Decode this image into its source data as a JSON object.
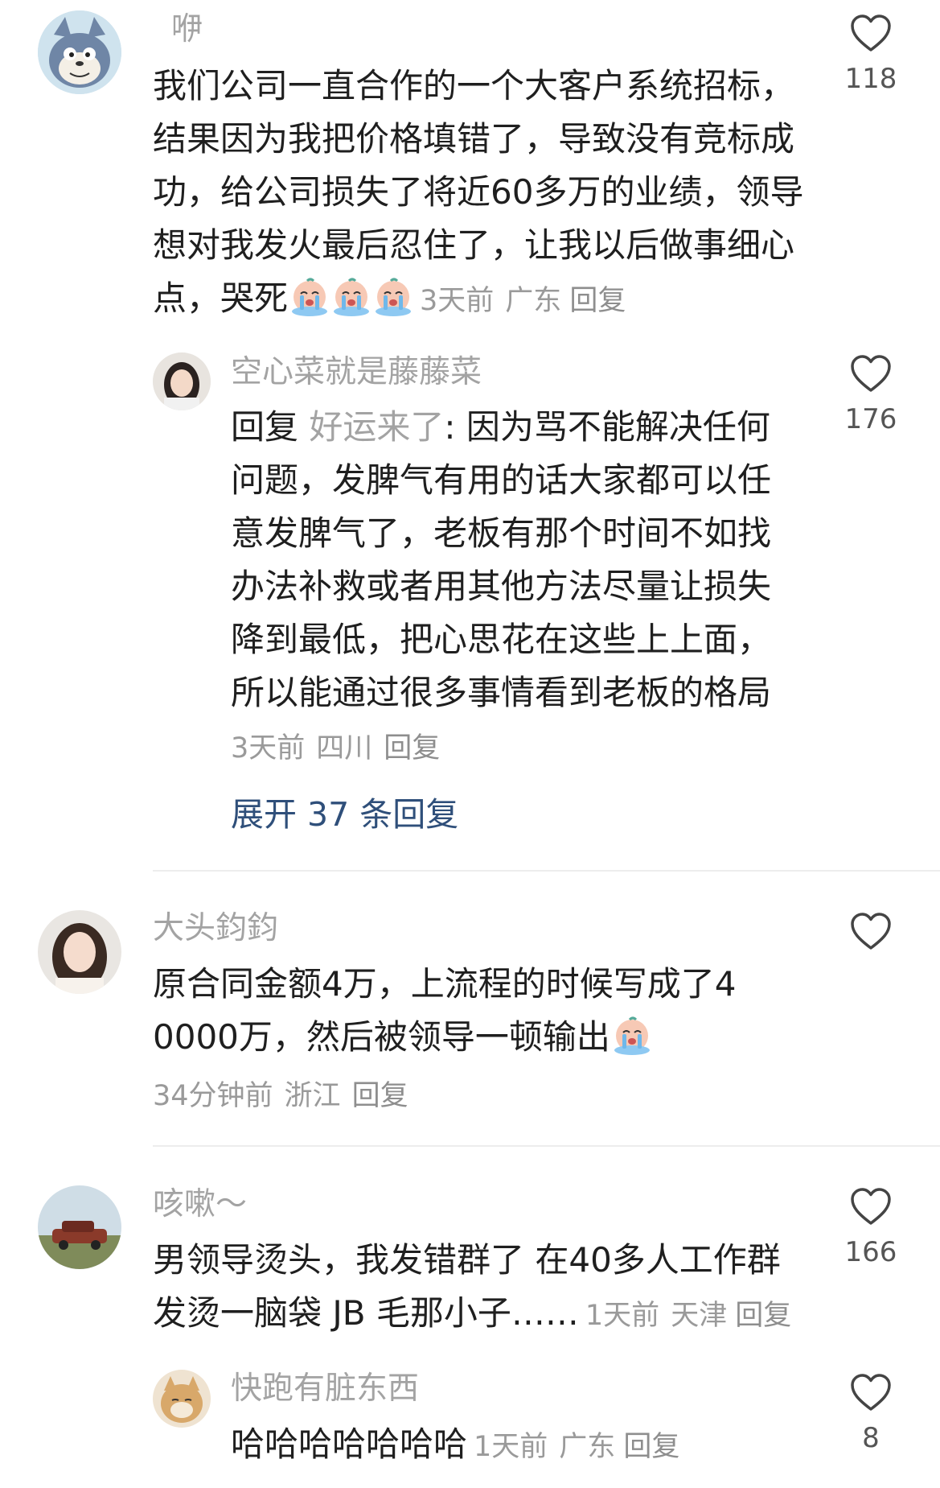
{
  "comments": [
    {
      "username": "咿",
      "text": "我们公司一直合作的一个大客户系统招标，结果因为我把价格填错了，导致没有竞标成功，给公司损失了将近60多万的业绩，领导想对我发火最后忍住了，让我以后做事细心点，哭死",
      "emojis": [
        "crying-face-icon",
        "crying-face-icon",
        "crying-face-icon"
      ],
      "time": "3天前",
      "location": "广东",
      "reply_label": "回复",
      "likes": "118"
    },
    {
      "username": "空心菜就是藤藤菜",
      "reply_prefix": "回复",
      "reply_target": "好运来了",
      "text": ": 因为骂不能解决任何问题，发脾气有用的话大家都可以任意发脾气了，老板有那个时间不如找办法补救或者用其他方法尽量让损失降到最低，把心思花在这些上上面，所以能通过很多事情看到老板的格局",
      "time": "3天前",
      "location": "四川",
      "reply_label": "回复",
      "likes": "176"
    },
    {
      "username": "大头鈞鈞",
      "text": "原合同金额4万，上流程的时候写成了40000万，然后被领导一顿输出",
      "emojis": [
        "crying-face-icon"
      ],
      "time": "34分钟前",
      "location": "浙江",
      "reply_label": "回复"
    },
    {
      "username": "咳嗽～",
      "text": "男领导烫头，我发错群了 在40多人工作群发烫一脑袋 JB 毛那小子……",
      "time": "1天前",
      "location": "天津",
      "reply_label": "回复",
      "likes": "166"
    },
    {
      "username": "快跑有脏东西",
      "text": "哈哈哈哈哈哈哈",
      "time": "1天前",
      "location": "广东",
      "reply_label": "回复",
      "likes": "8"
    }
  ],
  "expand_replies": "展开 37 条回复",
  "colors": {
    "text": "#1f1f1f",
    "username": "#a3a3a3",
    "meta": "#9a9a9a",
    "link": "#2f4f7a"
  }
}
